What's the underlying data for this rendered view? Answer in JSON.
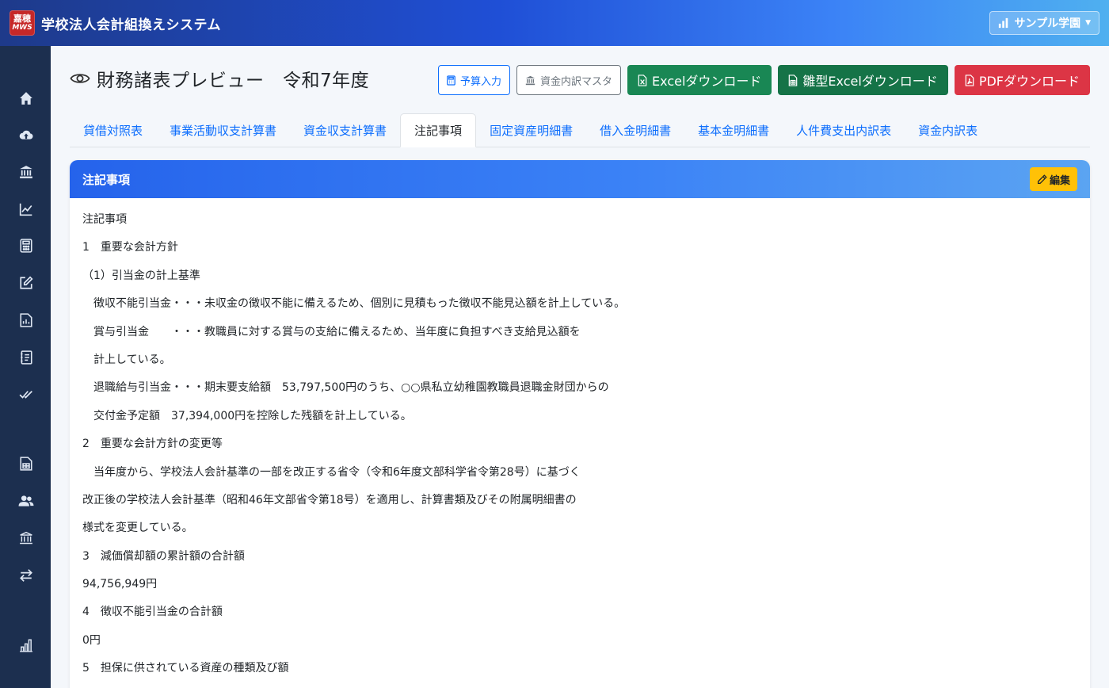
{
  "header": {
    "logo_line1": "嘉穂",
    "logo_line2": "MWS",
    "app_title": "学校法人会計組換えシステム",
    "school_name": "サンプル学園"
  },
  "sidebar": {
    "icons": [
      "home-icon",
      "cloud-upload-icon",
      "bank-icon",
      "chart-line-icon",
      "calculator-icon",
      "edit-icon",
      "report-icon",
      "journal-icon",
      "check-double-icon",
      "spreadsheet-icon",
      "users-icon",
      "institution-icon",
      "transfer-icon",
      "building-chart-icon"
    ]
  },
  "page": {
    "title": "財務諸表プレビュー　令和7年度"
  },
  "actions": {
    "budget_input": "予算入力",
    "fund_master": "資金内訳マスタ",
    "excel_download": "Excelダウンロード",
    "template_excel_download": "雛型Excelダウンロード",
    "pdf_download": "PDFダウンロード"
  },
  "tabs": [
    {
      "label": "貸借対照表",
      "active": false
    },
    {
      "label": "事業活動収支計算書",
      "active": false
    },
    {
      "label": "資金収支計算書",
      "active": false
    },
    {
      "label": "注記事項",
      "active": true
    },
    {
      "label": "固定資産明細書",
      "active": false
    },
    {
      "label": "借入金明細書",
      "active": false
    },
    {
      "label": "基本金明細書",
      "active": false
    },
    {
      "label": "人件費支出内訳表",
      "active": false
    },
    {
      "label": "資金内訳表",
      "active": false
    }
  ],
  "card": {
    "title": "注記事項",
    "edit_label": "編集",
    "lines": [
      "注記事項",
      "1　重要な会計方針",
      "（1）引当金の計上基準",
      "　徴収不能引当金・・・未収金の徴収不能に備えるため、個別に見積もった徴収不能見込額を計上している。",
      "　賞与引当金　　・・・教職員に対する賞与の支給に備えるため、当年度に負担すべき支給見込額を",
      "　計上している。",
      "　退職給与引当金・・・期末要支給額　53,797,500円のうち、○○県私立幼稚園教職員退職金財団からの",
      "　交付金予定額　37,394,000円を控除した残額を計上している。",
      "2　重要な会計方針の変更等",
      "　当年度から、学校法人会計基準の一部を改正する省令（令和6年度文部科学省令第28号）に基づく",
      "改正後の学校法人会計基準（昭和46年文部省令第18号）を適用し、計算書類及びその附属明細書の",
      "様式を変更している。",
      "3　減価償却額の累計額の合計額",
      "94,756,949円",
      "4　徴収不能引当金の合計額",
      "0円",
      "5　担保に供されている資産の種類及び額"
    ]
  }
}
